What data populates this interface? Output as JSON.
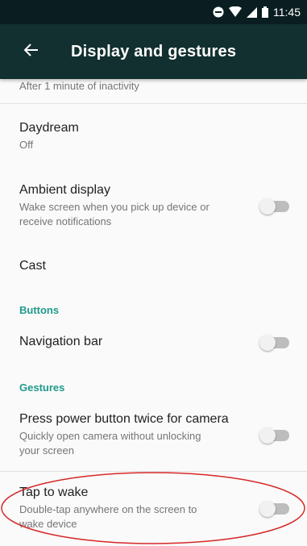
{
  "status_bar": {
    "time": "11:45"
  },
  "app_bar": {
    "title": "Display and gestures"
  },
  "sleep": {
    "summary": "After 1 minute of inactivity"
  },
  "daydream": {
    "title": "Daydream",
    "summary": "Off"
  },
  "ambient_display": {
    "title": "Ambient display",
    "summary_line1": "Wake screen when you pick up device or",
    "summary_line2": "receive notifications",
    "enabled": false
  },
  "cast": {
    "title": "Cast"
  },
  "buttons_header": "Buttons",
  "navigation_bar": {
    "title": "Navigation bar",
    "enabled": false
  },
  "gestures_header": "Gestures",
  "camera_gesture": {
    "title": "Press power button twice for camera",
    "summary_line1": "Quickly open camera without unlocking",
    "summary_line2": "your screen",
    "enabled": false
  },
  "tap_to_wake": {
    "title": "Tap to wake",
    "summary_line1": "Double-tap anywhere on the screen to",
    "summary_line2": "wake device",
    "enabled": false
  },
  "colors": {
    "app_bar": "#12302f",
    "status_bar": "#0a1e22",
    "accent": "#1f9a8c",
    "annotation": "#d62828"
  }
}
